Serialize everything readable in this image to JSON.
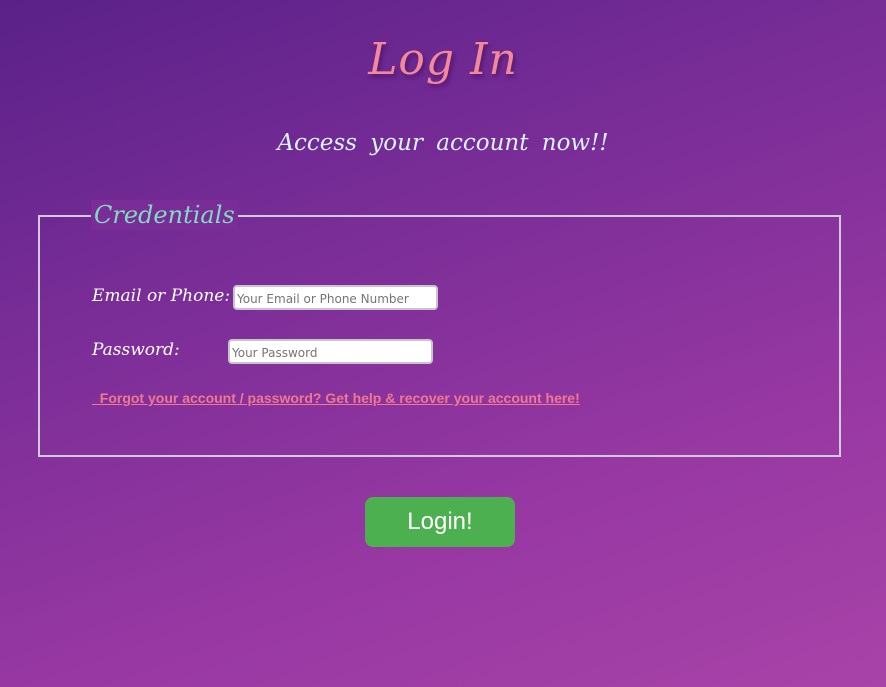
{
  "header": {
    "title": "Log In",
    "subtitle": "Access your account now!!"
  },
  "form": {
    "legend": "Credentials",
    "email": {
      "label": "Email or Phone:",
      "value": "",
      "placeholder": "Your Email or Phone Number"
    },
    "password": {
      "label": "Password:",
      "value": "",
      "placeholder": "Your Password"
    },
    "forgot_link": "  Forgot your account / password? Get help & recover your account here!"
  },
  "actions": {
    "login_label": "Login!"
  },
  "colors": {
    "title": "#f3889a",
    "subtitle": "#d6f3ff",
    "legend": "#7fdcc0",
    "link": "#f07890",
    "button": "#4caf50",
    "background_start": "#5a2189",
    "background_end": "#a843a8"
  }
}
